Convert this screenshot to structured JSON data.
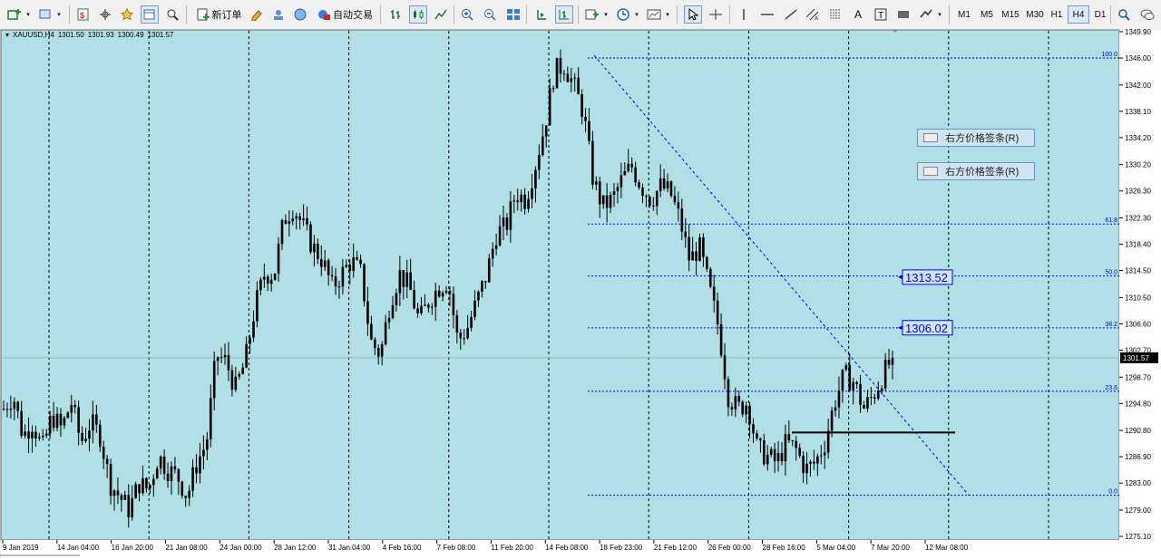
{
  "toolbar": {
    "new_order_label": "新订单",
    "auto_trading_label": "自动交易",
    "timeframes": [
      "M1",
      "M5",
      "M15",
      "M30",
      "H1",
      "H4",
      "D1"
    ],
    "active_timeframe": "H4"
  },
  "chart_info": {
    "symbol": "XAUUSD,H4",
    "open": "1301.50",
    "high": "1301.93",
    "low": "1300.49",
    "close": "1301.57"
  },
  "chart_data": {
    "type": "candlestick",
    "symbol": "XAUUSD",
    "timeframe": "H4",
    "ylim": [
      1275.1,
      1349.9
    ],
    "y_ticks": [
      "1349.90",
      "1346.00",
      "1342.00",
      "1338.10",
      "1334.20",
      "1330.20",
      "1326.30",
      "1322.30",
      "1318.40",
      "1314.50",
      "1310.50",
      "1306.60",
      "1302.70",
      "1298.70",
      "1294.80",
      "1290.80",
      "1286.90",
      "1283.00",
      "1279.00",
      "1275.10"
    ],
    "x_ticks": [
      "9 Jan 2019",
      "14 Jan 04:00",
      "16 Jan 20:00",
      "21 Jan 08:00",
      "24 Jan 00:00",
      "28 Jan 12:00",
      "31 Jan 04:00",
      "4 Feb 16:00",
      "7 Feb 08:00",
      "11 Feb 20:00",
      "14 Feb 08:00",
      "18 Feb 23:00",
      "21 Feb 12:00",
      "26 Feb 00:00",
      "28 Feb 16:00",
      "5 Mar 04:00",
      "7 Mar 20:00",
      "12 Mar 08:00"
    ],
    "price_path": [
      1294,
      1296,
      1290,
      1292,
      1288,
      1293,
      1291,
      1295,
      1289,
      1292,
      1290,
      1283,
      1281,
      1279,
      1283,
      1282,
      1287,
      1285,
      1284,
      1281,
      1286,
      1289,
      1302,
      1301,
      1297,
      1301,
      1309,
      1314,
      1314,
      1322,
      1324,
      1321,
      1318,
      1316,
      1312,
      1314,
      1316,
      1314,
      1304,
      1302,
      1310,
      1314,
      1312,
      1307,
      1310,
      1312,
      1313,
      1304,
      1306,
      1310,
      1314,
      1320,
      1321,
      1326,
      1325,
      1330,
      1336,
      1344,
      1345,
      1342,
      1338,
      1328,
      1324,
      1325,
      1328,
      1330,
      1327,
      1325,
      1327,
      1326,
      1322,
      1316,
      1318,
      1312,
      1306,
      1296,
      1294,
      1295,
      1288,
      1287,
      1286,
      1289,
      1288,
      1285,
      1286,
      1289,
      1295,
      1299,
      1298,
      1294,
      1296,
      1299,
      1301.57
    ],
    "current_price": "1301.57",
    "fibonacci": {
      "levels": [
        {
          "label": "100.0",
          "price": 1346.0
        },
        {
          "label": "61.8",
          "price": 1321.4
        },
        {
          "label": "50.0",
          "price": 1313.7
        },
        {
          "label": "38.2",
          "price": 1306.0
        },
        {
          "label": "23.6",
          "price": 1296.6
        },
        {
          "label": "0.0",
          "price": 1281.2
        }
      ],
      "trendline": {
        "from_price": 1346.4,
        "to_price": 1281.2
      }
    },
    "price_labels": [
      "1313.52",
      "1306.02"
    ],
    "horizontal_line_price": 1290.5,
    "grid": true,
    "background_color": "#b0dfe5",
    "candle_color": "#000000",
    "fib_color": "#0000ff"
  },
  "right_price_tags": [
    "右方价格签条(R)",
    "右方价格签条(R)"
  ]
}
